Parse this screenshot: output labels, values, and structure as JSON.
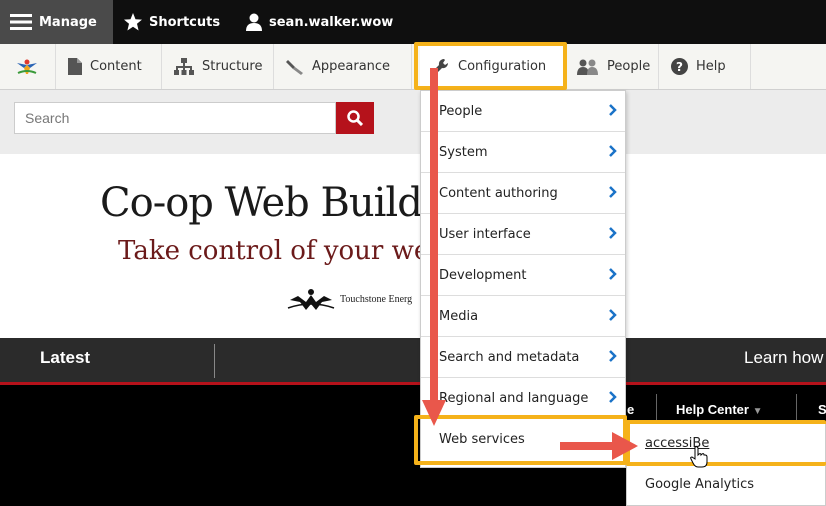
{
  "toolbar": {
    "manage_label": "Manage",
    "shortcuts_label": "Shortcuts",
    "user_label": "sean.walker.wow"
  },
  "tray": {
    "items": [
      {
        "label": "Content",
        "icon": "file-icon"
      },
      {
        "label": "Structure",
        "icon": "sitemap-icon"
      },
      {
        "label": "Appearance",
        "icon": "paintbrush-icon"
      },
      {
        "label": "Configuration",
        "icon": "wrench-icon"
      },
      {
        "label": "People",
        "icon": "people-icon"
      },
      {
        "label": "Help",
        "icon": "help-icon"
      }
    ]
  },
  "search": {
    "placeholder": "Search"
  },
  "banner": {
    "title": "Co-op Web Build",
    "tagline": "Take control of your we",
    "logo_text": "Touchstone Energ"
  },
  "nav": {
    "latest": "Latest",
    "learn": "Learn how",
    "help_center": "Help Center",
    "partial_left": "e",
    "partial_right": "S"
  },
  "config_menu": {
    "items": [
      "People",
      "System",
      "Content authoring",
      "User interface",
      "Development",
      "Media",
      "Search and metadata",
      "Regional and language",
      "Web services"
    ]
  },
  "web_services_menu": {
    "items": [
      "accessiBe",
      "Google Analytics"
    ]
  },
  "colors": {
    "highlight": "#f5b21a",
    "arrow": "#e9574b",
    "accent_red": "#b5121b",
    "chevron_blue": "#1a73c8"
  }
}
